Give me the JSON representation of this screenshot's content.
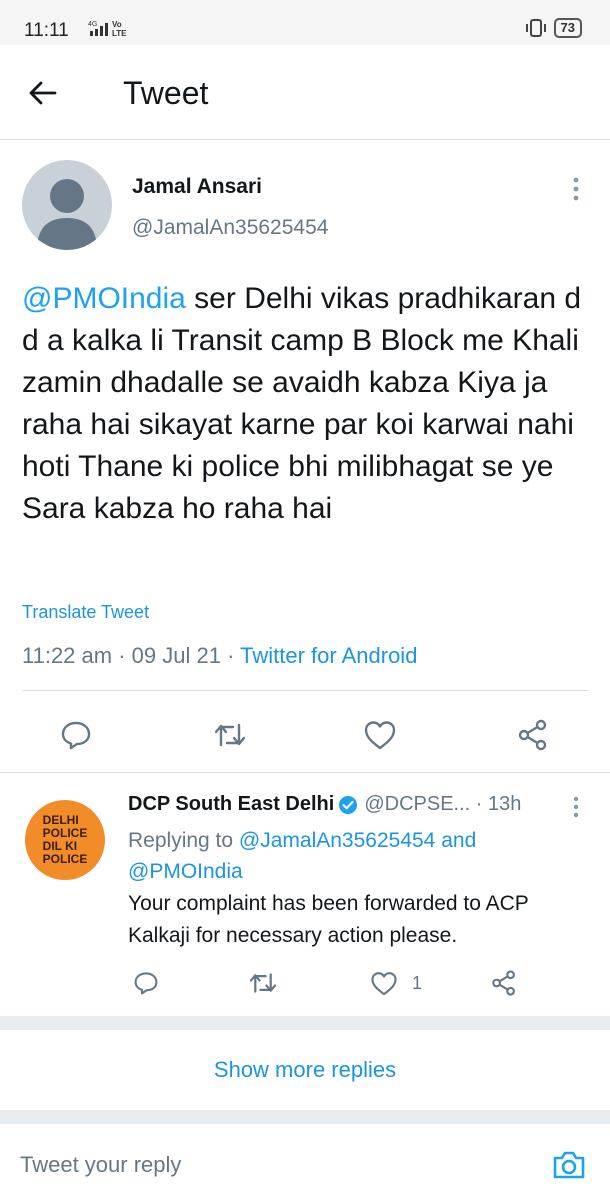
{
  "status_bar": {
    "time": "11:11",
    "network": "4G",
    "volte": "Vo LTE",
    "battery": "73"
  },
  "header": {
    "title": "Tweet"
  },
  "tweet": {
    "author_name": "Jamal Ansari",
    "author_handle": "@JamalAn35625454",
    "mention": "@PMOIndia",
    "text": " ser  Delhi vikas pradhikaran  d d a kalka li  Transit camp B Block me  Khali zamin dhadalle se avaidh kabza Kiya ja raha hai  sikayat karne par koi karwai nahi hoti  Thane ki police bhi milibhagat se ye Sara kabza ho raha hai",
    "translate_label": "Translate Tweet",
    "time": "11:22 am",
    "date": "09 Jul 21",
    "source": "Twitter for Android"
  },
  "reply": {
    "avatar_lines": [
      "DELHI",
      "POLICE",
      "DIL KI",
      "POLICE"
    ],
    "name": "DCP South East Delhi",
    "handle": "@DCPSE...",
    "age": "13h",
    "replying_prefix": "Replying to ",
    "replying_mention_1": "@JamalAn35625454",
    "replying_and": " and",
    "replying_mention_2": "@PMOIndia",
    "text": "Your complaint has been forwarded to ACP Kalkaji for necessary action please.",
    "like_count": "1"
  },
  "show_more_label": "Show more replies",
  "reply_input_placeholder": "Tweet your reply",
  "colors": {
    "accent": "#1da1f2",
    "link": "#1b95e0",
    "muted": "#657786",
    "divider": "#d8dde1",
    "dcp_orange": "#f28c28"
  },
  "icons": [
    "back-arrow-icon",
    "more-vertical-icon",
    "reply-icon",
    "retweet-icon",
    "like-icon",
    "share-icon",
    "verified-icon",
    "camera-icon"
  ]
}
